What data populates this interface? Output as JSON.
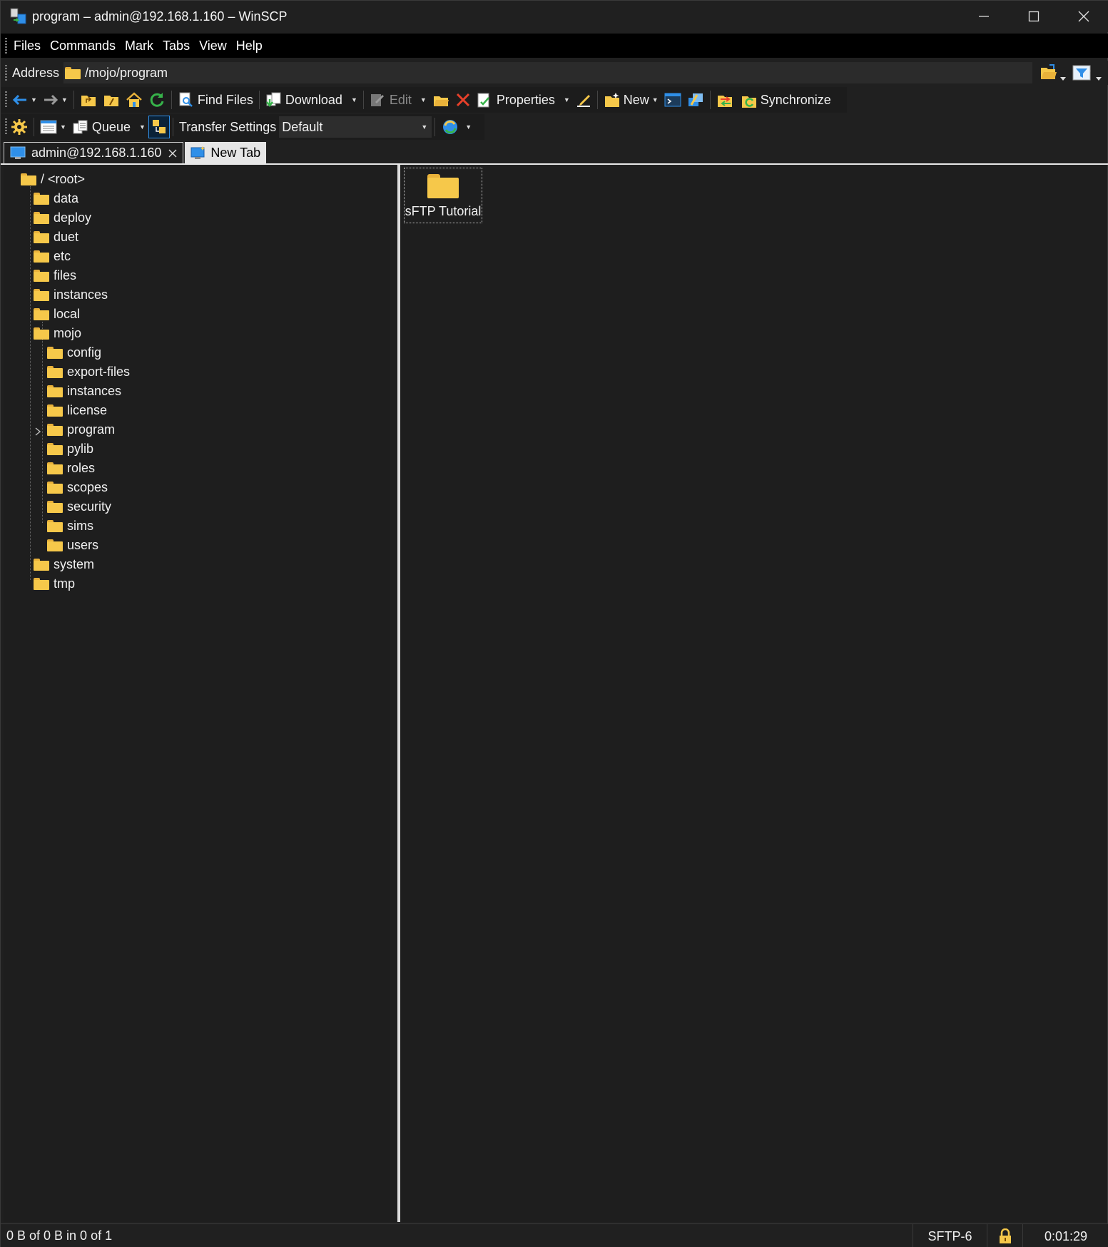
{
  "window": {
    "title": "program – admin@192.168.1.160 – WinSCP"
  },
  "menu": [
    "Files",
    "Commands",
    "Mark",
    "Tabs",
    "View",
    "Help"
  ],
  "address": {
    "label": "Address",
    "path": "/mojo/program"
  },
  "toolbar1": {
    "find_files": "Find Files",
    "download": "Download",
    "edit": "Edit",
    "properties": "Properties",
    "new": "New",
    "synchronize": "Synchronize"
  },
  "toolbar2": {
    "queue": "Queue",
    "transfer_settings": "Transfer Settings",
    "transfer_value": "Default"
  },
  "tabs": {
    "session": "admin@192.168.1.160",
    "new_tab": "New Tab"
  },
  "tree": {
    "root": "/ <root>",
    "level1": [
      "data",
      "deploy",
      "duet",
      "etc",
      "files",
      "instances",
      "local",
      "mojo"
    ],
    "mojo_children": [
      "config",
      "export-files",
      "instances",
      "license",
      "program",
      "pylib",
      "roles",
      "scopes",
      "security",
      "sims",
      "users"
    ],
    "level1_after": [
      "system",
      "tmp"
    ]
  },
  "files": [
    {
      "name": "sFTP Tutorial"
    }
  ],
  "status": {
    "summary": "0 B of 0 B in 0 of 1",
    "protocol": "SFTP-6",
    "elapsed": "0:01:29"
  },
  "colors": {
    "folder": "#f6c84a",
    "accent_blue": "#2f8fe8",
    "delete_red": "#e8402a",
    "refresh_green": "#37b34a"
  }
}
